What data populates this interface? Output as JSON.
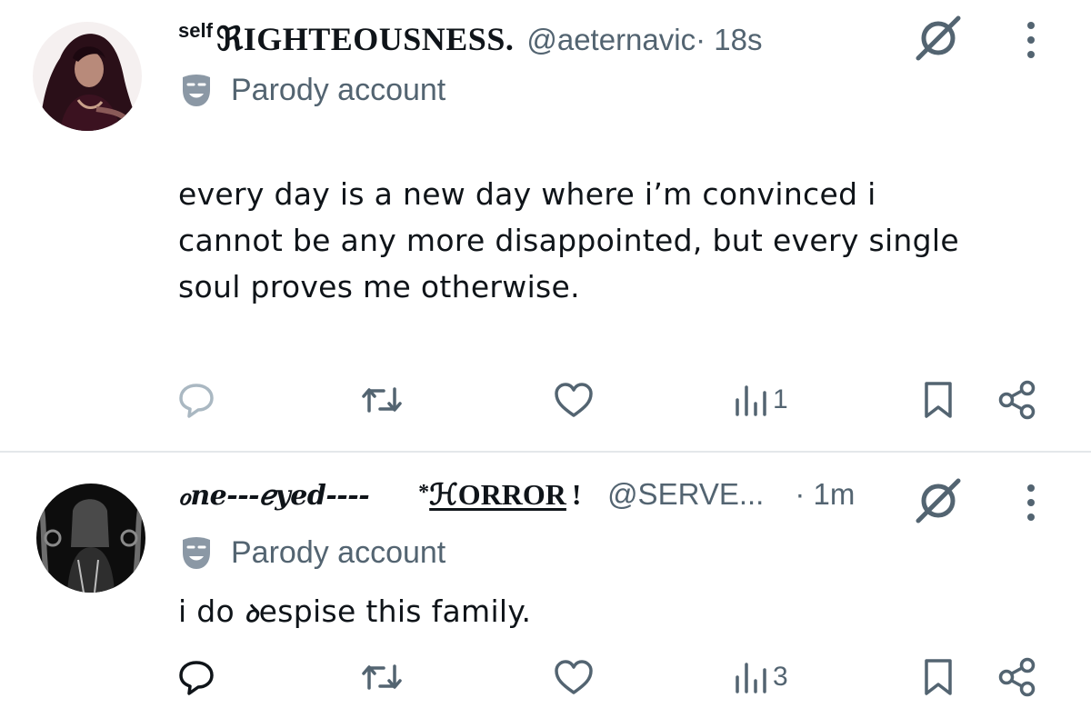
{
  "posts": [
    {
      "display_name_small": "self",
      "display_name_main": "ℜIGHTEOUSNESS.",
      "handle": "@aeternavic",
      "time": "· 18s",
      "parody_label": "Parody account",
      "text_lines": [
        "every day is a new day where i’m convinced i",
        "cannot be any more disappointed, but every single",
        "soul proves me otherwise."
      ],
      "views": "1",
      "icons": {
        "reply": "reply-icon",
        "repost": "repost-icon",
        "like": "heart-icon",
        "views": "views-bar-chart-icon",
        "bookmark": "bookmark-icon",
        "share": "share-icon",
        "verified": "slashed-circle-icon",
        "more": "more-vertical-icon",
        "parody": "theater-mask-icon"
      }
    },
    {
      "display_name_part1": "ℴne---ℯyed----",
      "display_name_star": "*",
      "display_name_part2": "ℋORROR",
      "display_name_end": "!",
      "handle": "@SERVE...",
      "time": "· 1m",
      "parody_label": "Parody account",
      "text_before": "i do ",
      "text_deco": "ꝺ",
      "text_after": "espise this family.",
      "views": "3"
    }
  ],
  "colors": {
    "text": "#0f1419",
    "secondary": "#536471",
    "divider": "#e4e7ea",
    "reply_icon_light": "#aab8c2"
  }
}
